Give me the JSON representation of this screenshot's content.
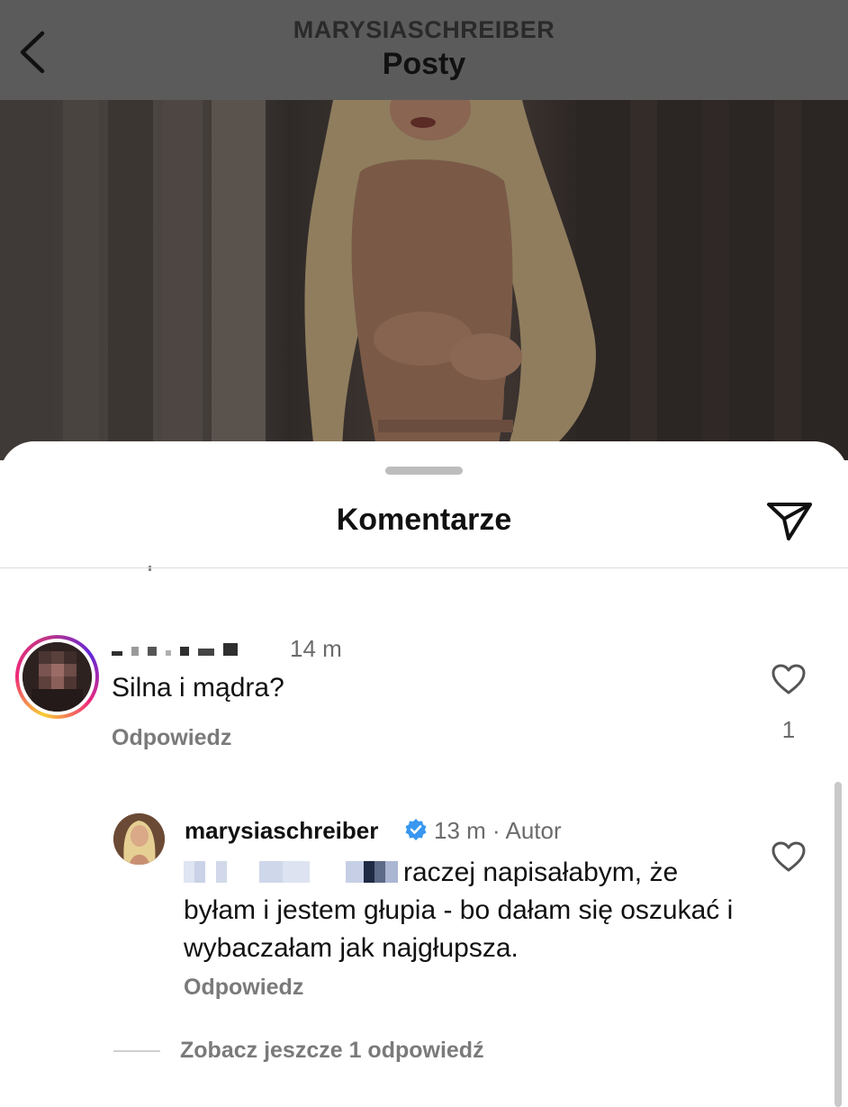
{
  "header": {
    "username": "MARYSIASCHREIBER",
    "title": "Posty",
    "back_icon": "chevron-left-icon"
  },
  "sheet": {
    "title": "Komentarze",
    "share_icon": "paper-plane-icon"
  },
  "comments": [
    {
      "username_redacted": true,
      "time": "14 m",
      "text": "Silna i mądra?",
      "reply_label": "Odpowiedz",
      "like_icon": "heart-outline-icon",
      "like_count": "1"
    },
    {
      "username": "marysiaschreiber",
      "verified": true,
      "meta": "13 m · Autor",
      "mention_redacted": true,
      "text": "raczej napisałabym, że byłam i jestem głupia - bo dałam się oszukać i wybaczałam jak najgłupsza.",
      "reply_label": "Odpowiedz",
      "like_icon": "heart-outline-icon"
    }
  ],
  "more_replies_label": "Zobacz jeszcze 1 odpowiedź",
  "colors": {
    "header_bg": "#5b5b5b",
    "verified_blue": "#3897f0",
    "secondary_text": "#6b6b6b"
  }
}
